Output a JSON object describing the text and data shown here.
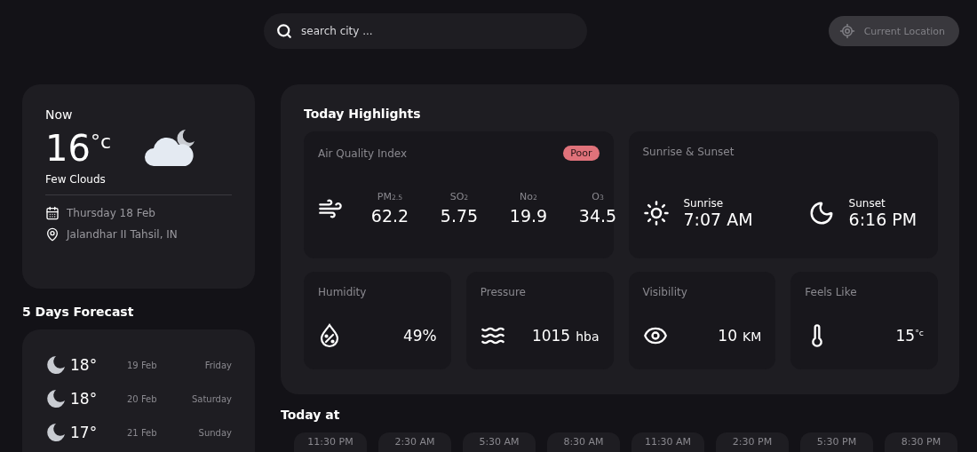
{
  "search": {
    "placeholder": "search city ..."
  },
  "location_button": {
    "label": "Current Location"
  },
  "now": {
    "title": "Now",
    "temperature": "16$^{°c}$",
    "condition": "Few Clouds",
    "date": "Thursday 18 Feb",
    "place": "Jalandhar II Tahsil, IN"
  },
  "forecast": {
    "title": "5 Days Forecast",
    "days": [
      {
        "temp": "18°",
        "date": "19 Feb",
        "weekday": "Friday"
      },
      {
        "temp": "18°",
        "date": "20 Feb",
        "weekday": "Saturday"
      },
      {
        "temp": "17°",
        "date": "21 Feb",
        "weekday": "Sunday"
      }
    ]
  },
  "highlights": {
    "title": "Today Highlights",
    "air_quality": {
      "title": "Air Quality Index",
      "badge": "Poor",
      "pollutants": [
        {
          "label": "PM$_{2.5}$",
          "value": "62.2"
        },
        {
          "label": "SO$_{2}$",
          "value": "5.75"
        },
        {
          "label": "No$_{2}$",
          "value": "19.9"
        },
        {
          "label": "O$_{3}$",
          "value": "34.5"
        }
      ]
    },
    "sun": {
      "title": "Sunrise & Sunset",
      "events": [
        {
          "kind": "sunrise",
          "label": "Sunrise",
          "time": "7:07 AM"
        },
        {
          "kind": "sunset",
          "label": "Sunset",
          "time": "6:16 PM"
        }
      ]
    },
    "metrics": [
      {
        "kind": "humidity",
        "title": "Humidity",
        "value": "49%"
      },
      {
        "kind": "pressure",
        "title": "Pressure",
        "value": "1015",
        "unit": "hba"
      },
      {
        "kind": "visibility",
        "title": "Visibility",
        "value": "10",
        "unit": "KM"
      },
      {
        "kind": "feels_like",
        "title": "Feels Like",
        "value": "15$^{°c}$"
      }
    ]
  },
  "hourly": {
    "title": "Today at",
    "times": [
      "11:30 PM",
      "2:30 AM",
      "5:30 AM",
      "8:30 AM",
      "11:30 AM",
      "2:30 PM",
      "5:30 PM",
      "8:30 PM"
    ]
  }
}
